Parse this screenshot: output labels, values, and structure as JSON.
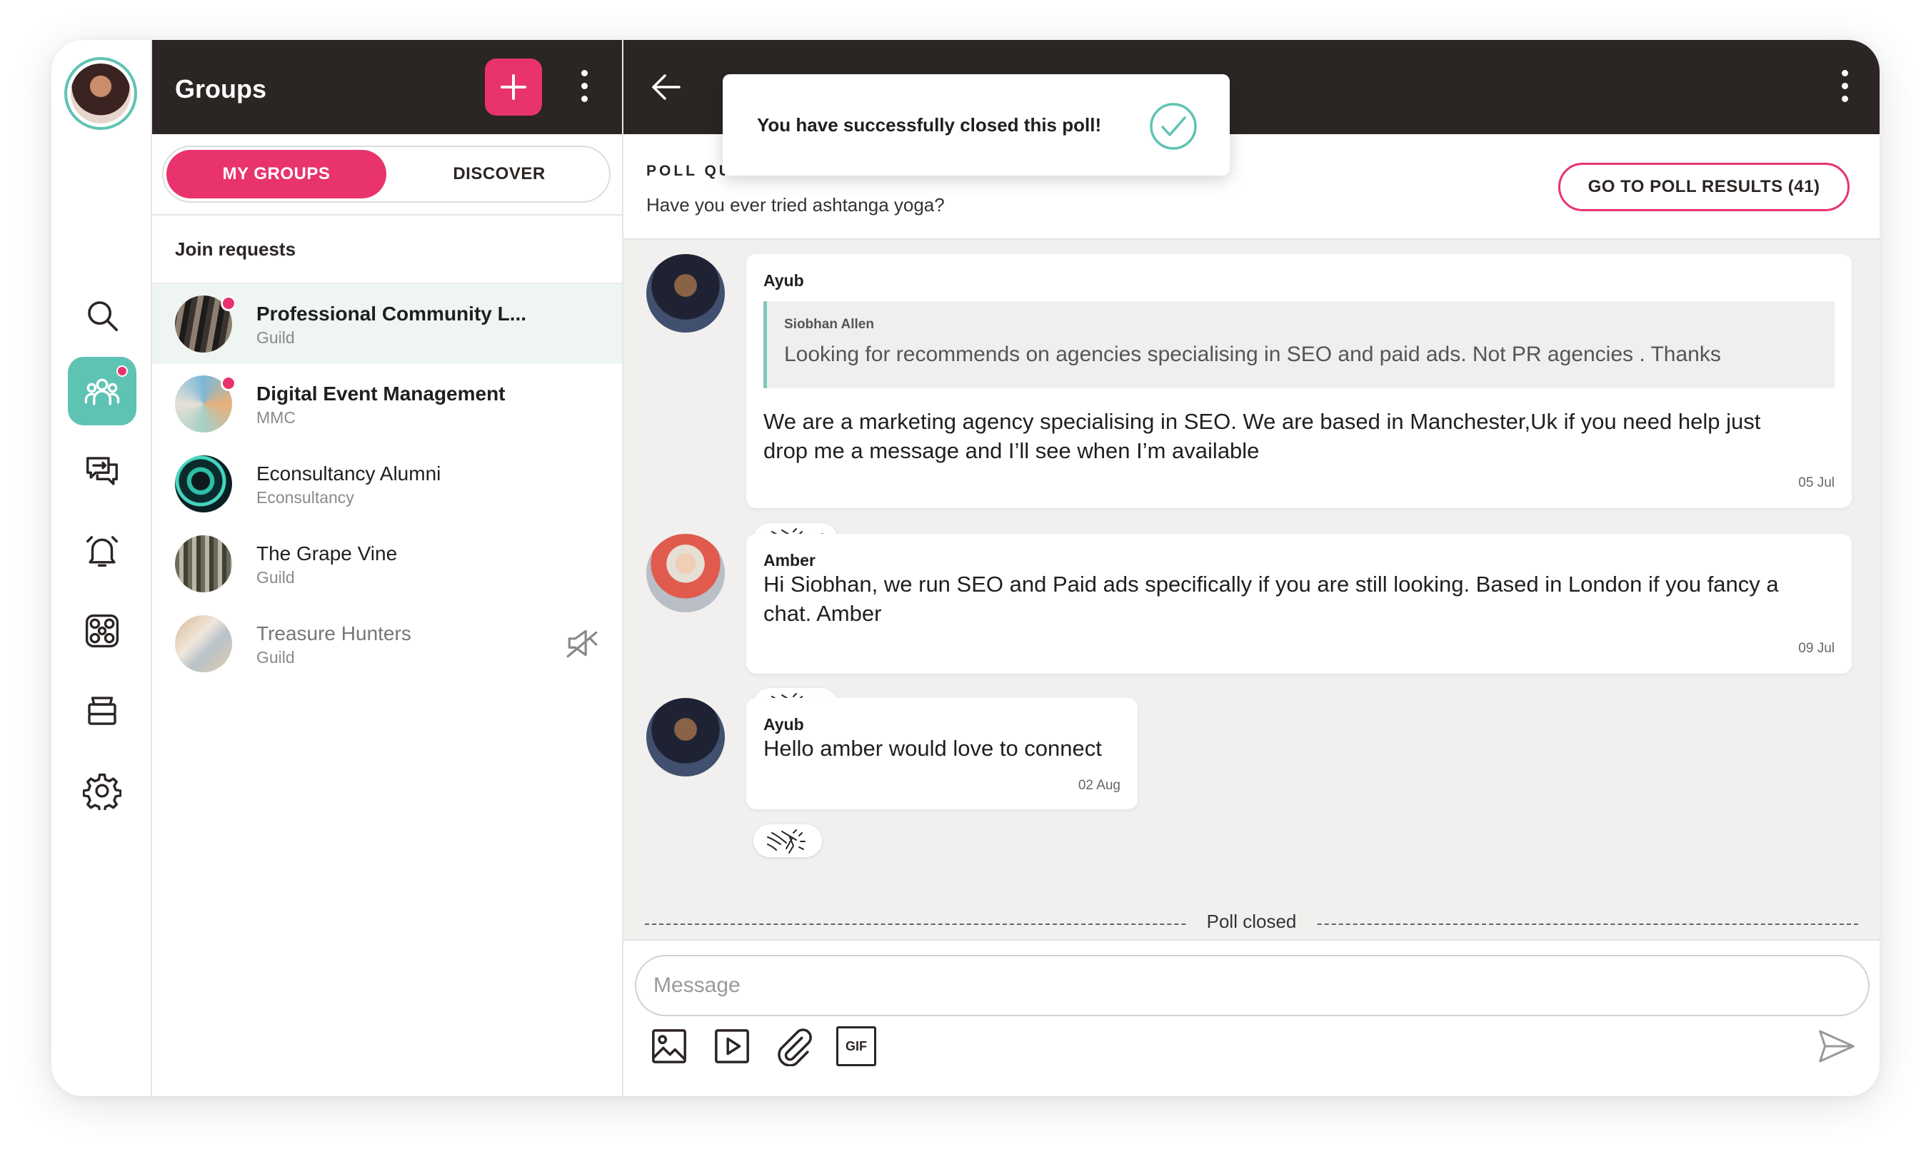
{
  "groups_panel": {
    "title": "Groups",
    "tabs": {
      "active": "MY GROUPS",
      "inactive": "DISCOVER"
    },
    "section": "Join requests",
    "items": [
      {
        "name": "Professional Community L...",
        "sub": "Guild",
        "unread": true,
        "bold": true,
        "selected": true
      },
      {
        "name": "Digital Event Management",
        "sub": "MMC",
        "unread": true,
        "bold": true,
        "selected": false
      },
      {
        "name": "Econsultancy Alumni",
        "sub": "Econsultancy",
        "unread": false,
        "bold": false,
        "selected": false
      },
      {
        "name": "The Grape Vine",
        "sub": "Guild",
        "unread": false,
        "bold": false,
        "selected": false
      },
      {
        "name": "Treasure Hunters",
        "sub": "Guild",
        "unread": false,
        "bold": false,
        "muted": true,
        "selected": false
      }
    ]
  },
  "toast": {
    "text": "You have successfully closed this poll!"
  },
  "poll": {
    "label": "POLL QUESTION",
    "question": "Have you ever tried ashtanga yoga?",
    "results_button": "GO TO POLL RESULTS (41)"
  },
  "messages": [
    {
      "author": "Ayub",
      "quote_author": "Siobhan Allen",
      "quote_text": "Looking for recommends on agencies specialising in SEO and paid ads. Not PR agencies . Thanks",
      "text_line1": "We  are a marketing agency specialising in SEO. We are based in Manchester,Uk if you need help just",
      "text_line2": "drop me a message and I’ll see when I’m available",
      "time": "05 Jul",
      "reactions": "1"
    },
    {
      "author": "Amber",
      "text_line1": "Hi Siobhan, we run SEO and Paid ads specifically if you are still looking. Based in London if you fancy a",
      "text_line2": "chat. Amber",
      "time": "09 Jul",
      "reactions": "2"
    },
    {
      "author": "Ayub",
      "text_line1": "Hello amber would love to connect",
      "time": "02 Aug",
      "reactions": ""
    }
  ],
  "poll_closed_label": "Poll closed",
  "composer": {
    "placeholder": "Message",
    "tools": [
      "image-icon",
      "video-icon",
      "attachment-icon",
      "gif-icon"
    ],
    "gif_label": "GIF"
  },
  "colors": {
    "accent": "#e8336d",
    "teal": "#5fc3b3",
    "header": "#2b2523",
    "chat_bg": "#f1f0ee"
  }
}
